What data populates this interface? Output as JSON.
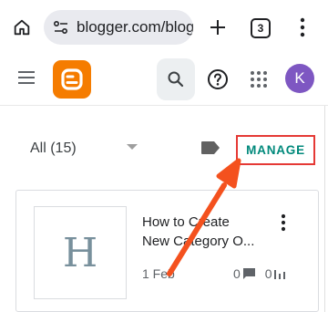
{
  "browser": {
    "url": "blogger.com/blog",
    "tab_count": "3",
    "icons": {
      "home": "home-icon",
      "site_info": "site-settings-icon",
      "new_tab": "plus-icon",
      "menu": "more-vert-icon"
    }
  },
  "header": {
    "logo": "blogger-logo",
    "avatar_letter": "K",
    "colors": {
      "logo": "#f57c00",
      "avatar": "#7e57c2"
    }
  },
  "filter": {
    "label": "All (15)",
    "manage_label": "MANAGE",
    "colors": {
      "manage_text": "#00897b",
      "highlight_box": "#e53935"
    }
  },
  "post": {
    "thumbnail_letter": "H",
    "title_line1": "How to Create",
    "title_line2": "New Category O...",
    "date": "1 Feb",
    "comments": "0",
    "views": "0"
  },
  "annotation": {
    "arrow_color": "#f4511e"
  }
}
